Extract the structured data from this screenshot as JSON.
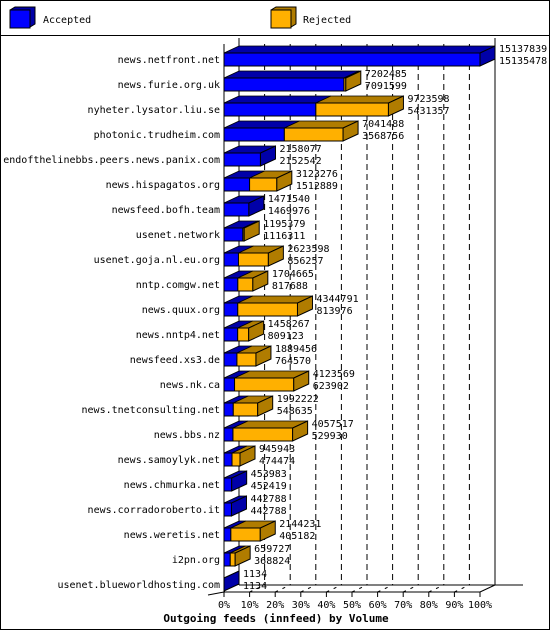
{
  "legend": {
    "accepted_label": "Accepted",
    "rejected_label": "Rejected"
  },
  "colors": {
    "accepted_front": "#0000ff",
    "accepted_side": "#0000a8",
    "rejected_front": "#ffb000",
    "rejected_side": "#b07c00"
  },
  "chart_data": {
    "type": "bar",
    "orientation": "horizontal",
    "stacked": true,
    "title": "Outgoing feeds (innfeed) by Volume",
    "xlabel": "",
    "ylabel": "",
    "xlim": [
      0,
      100
    ],
    "x_unit": "percent of maximum offered volume",
    "x_ticks": [
      "0%",
      "10%",
      "20%",
      "30%",
      "40%",
      "50%",
      "60%",
      "70%",
      "80%",
      "90%",
      "100%"
    ],
    "grid": "vertical dashed",
    "legend_position": "top",
    "value_labels_note": "Upper number = offered (total), lower number = accepted",
    "categories": [
      "news.netfront.net",
      "news.furie.org.uk",
      "nyheter.lysator.liu.se",
      "photonic.trudheim.com",
      "endofthelinebbs.peers.news.panix.com",
      "news.hispagatos.org",
      "newsfeed.bofh.team",
      "usenet.network",
      "usenet.goja.nl.eu.org",
      "nntp.comgw.net",
      "news.quux.org",
      "news.nntp4.net",
      "newsfeed.xs3.de",
      "news.nk.ca",
      "news.tnetconsulting.net",
      "news.bbs.nz",
      "news.samoylyk.net",
      "news.chmurka.net",
      "news.corradoroberto.it",
      "news.weretis.net",
      "i2pn.org",
      "usenet.blueworldhosting.com"
    ],
    "offered": [
      15137839,
      7202485,
      9723598,
      7041488,
      2158077,
      3123276,
      1471540,
      1195379,
      2623598,
      1704665,
      4344791,
      1458267,
      1889456,
      4123569,
      1992222,
      4057517,
      945943,
      453983,
      442788,
      2144231,
      659727,
      1134
    ],
    "series": [
      {
        "name": "Accepted",
        "values": [
          15135478,
          7091599,
          5431357,
          3568756,
          2152542,
          1512889,
          1469976,
          1116311,
          856257,
          817688,
          813976,
          809123,
          764570,
          623902,
          548635,
          529930,
          474474,
          452419,
          442788,
          405182,
          368824,
          1134
        ]
      },
      {
        "name": "Rejected",
        "values": [
          2361,
          110886,
          4292241,
          3472732,
          5535,
          1610387,
          1564,
          79068,
          1767341,
          886977,
          3530815,
          649144,
          1124886,
          3499667,
          1443587,
          3527587,
          471469,
          1564,
          0,
          1739049,
          290903,
          0
        ]
      }
    ]
  }
}
